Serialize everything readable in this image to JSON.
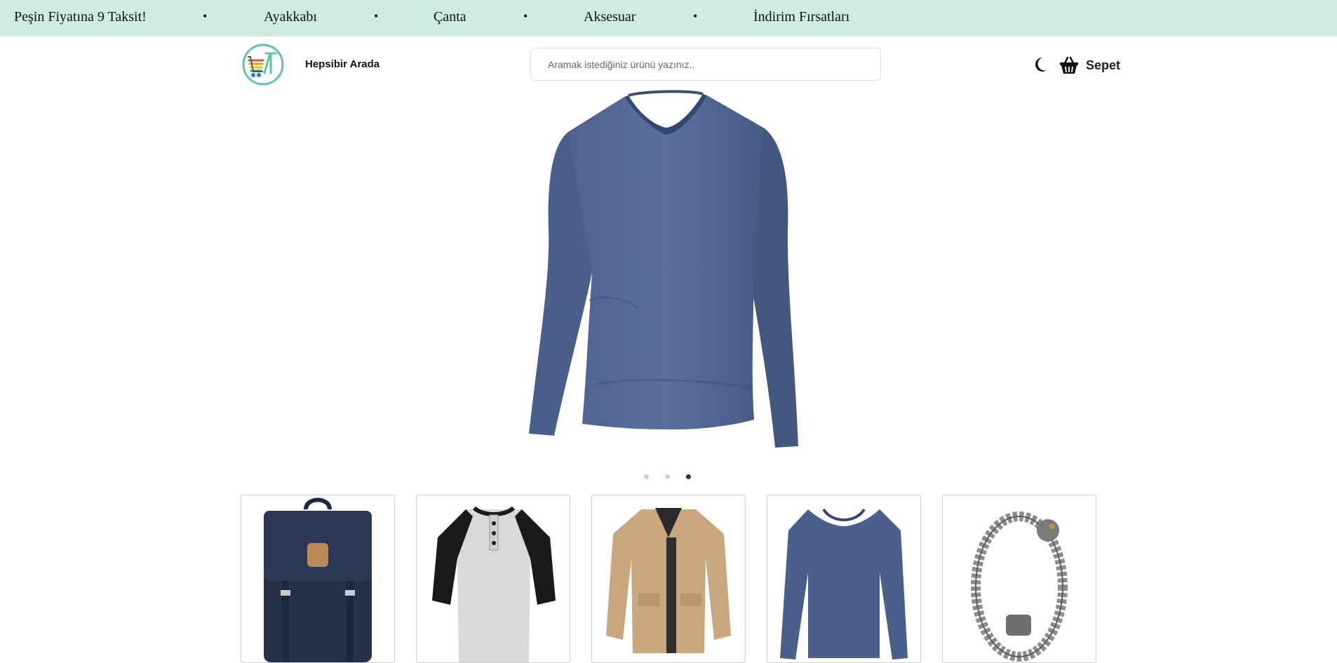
{
  "announcement": {
    "promo": "Peşin Fiyatına 9 Taksit!",
    "links": [
      "Ayakkabı",
      "Çanta",
      "Aksesuar",
      "İndirim Fırsatları"
    ],
    "separator": "•"
  },
  "header": {
    "brand": "Hepsibir Arada",
    "search_placeholder": "Aramak istediğiniz ürünü yazınız..",
    "cart_label": "Sepet"
  },
  "hero": {
    "product": "long-sleeve-vneck-shirt",
    "slide_count": 3,
    "active_slide": 3
  },
  "products": [
    {
      "kind": "backpack",
      "color": "#26324a"
    },
    {
      "kind": "raglan-shirt",
      "color": "#d8d8d8"
    },
    {
      "kind": "jacket",
      "color": "#c9a77e"
    },
    {
      "kind": "long-sleeve-shirt",
      "color": "#4a5f8c"
    },
    {
      "kind": "bracelet",
      "color": "#9a9a9a"
    }
  ],
  "colors": {
    "topbar": "#cdebe3",
    "accent": "#5fc4ac"
  }
}
